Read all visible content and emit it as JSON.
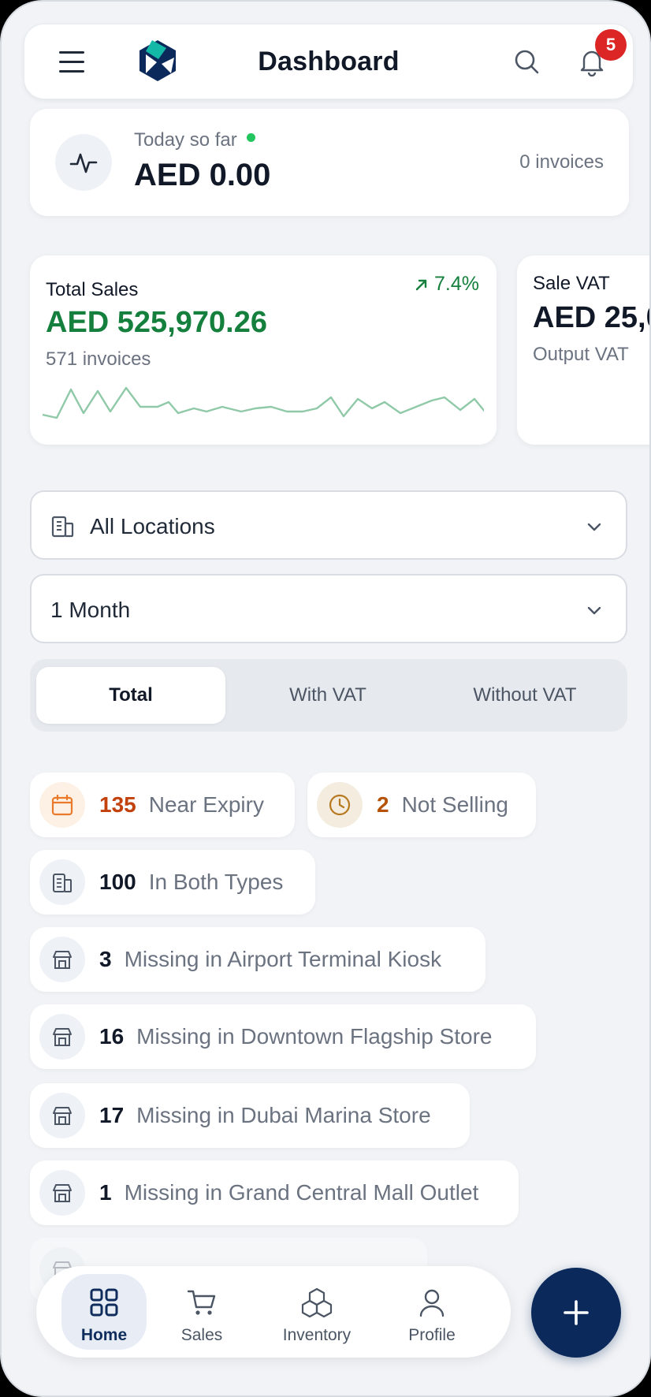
{
  "header": {
    "title": "Dashboard",
    "notification_count": "5"
  },
  "today": {
    "label": "Today so far",
    "amount": "AED 0.00",
    "invoices": "0 invoices"
  },
  "cards": [
    {
      "label": "Total Sales",
      "trend": "7.4%",
      "amount": "AED 525,970.26",
      "sub": "571 invoices"
    },
    {
      "label": "Sale VAT",
      "amount": "AED 25,0",
      "sub": "Output VAT"
    }
  ],
  "filters": {
    "location": "All Locations",
    "period": "1 Month"
  },
  "segments": {
    "total": "Total",
    "with_vat": "With VAT",
    "without_vat": "Without VAT"
  },
  "chips": {
    "near_expiry": {
      "count": "135",
      "label": "Near Expiry"
    },
    "not_selling": {
      "count": "2",
      "label": "Not Selling"
    },
    "both_types": {
      "count": "100",
      "label": "In Both Types"
    },
    "missing": [
      {
        "count": "3",
        "label": "Missing in Airport Terminal Kiosk"
      },
      {
        "count": "16",
        "label": "Missing in Downtown Flagship Store"
      },
      {
        "count": "17",
        "label": "Missing in Dubai Marina Store"
      },
      {
        "count": "1",
        "label": "Missing in Grand Central Mall Outlet"
      }
    ]
  },
  "nav": {
    "home": "Home",
    "sales": "Sales",
    "inventory": "Inventory",
    "profile": "Profile"
  },
  "colors": {
    "accent": "#0b2a5b",
    "positive": "#15803d",
    "warning": "#c2410c",
    "badge": "#dc2626"
  }
}
